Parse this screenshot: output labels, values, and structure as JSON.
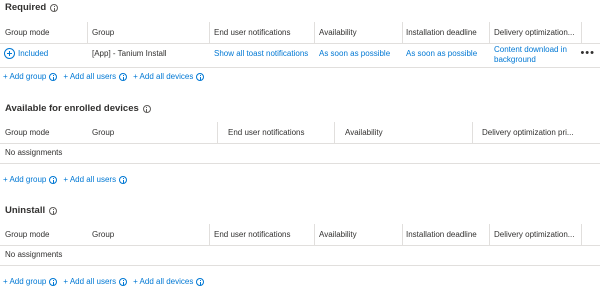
{
  "required": {
    "title": "Required",
    "headers": [
      "Group mode",
      "Group",
      "End user notifications",
      "Availability",
      "Installation deadline",
      "Delivery optimization..."
    ],
    "row": {
      "group_mode": "Included",
      "group": "[App] - Tanium Install",
      "notifications": "Show all toast notifications",
      "availability": "As soon as possible",
      "deadline": "As soon as possible",
      "delivery_line1": "Content download in",
      "delivery_line2": "background",
      "more": "•••"
    },
    "actions": [
      "+ Add group",
      "+ Add all users",
      "+ Add all devices"
    ]
  },
  "available": {
    "title": "Available for enrolled devices",
    "headers": [
      "Group mode",
      "Group",
      "End user notifications",
      "Availability",
      "Delivery optimization pri..."
    ],
    "empty": "No assignments",
    "actions": [
      "+ Add group",
      "+ Add all users"
    ]
  },
  "uninstall": {
    "title": "Uninstall",
    "headers": [
      "Group mode",
      "Group",
      "End user notifications",
      "Availability",
      "Installation deadline",
      "Delivery optimization..."
    ],
    "empty": "No assignments",
    "actions": [
      "+ Add group",
      "+ Add all users",
      "+ Add all devices"
    ]
  },
  "colors": {
    "link": "#0078d4",
    "text": "#323130",
    "border": "#e1dfdd"
  },
  "icons": [
    "info-icon",
    "add-circle-icon",
    "more-icon"
  ]
}
